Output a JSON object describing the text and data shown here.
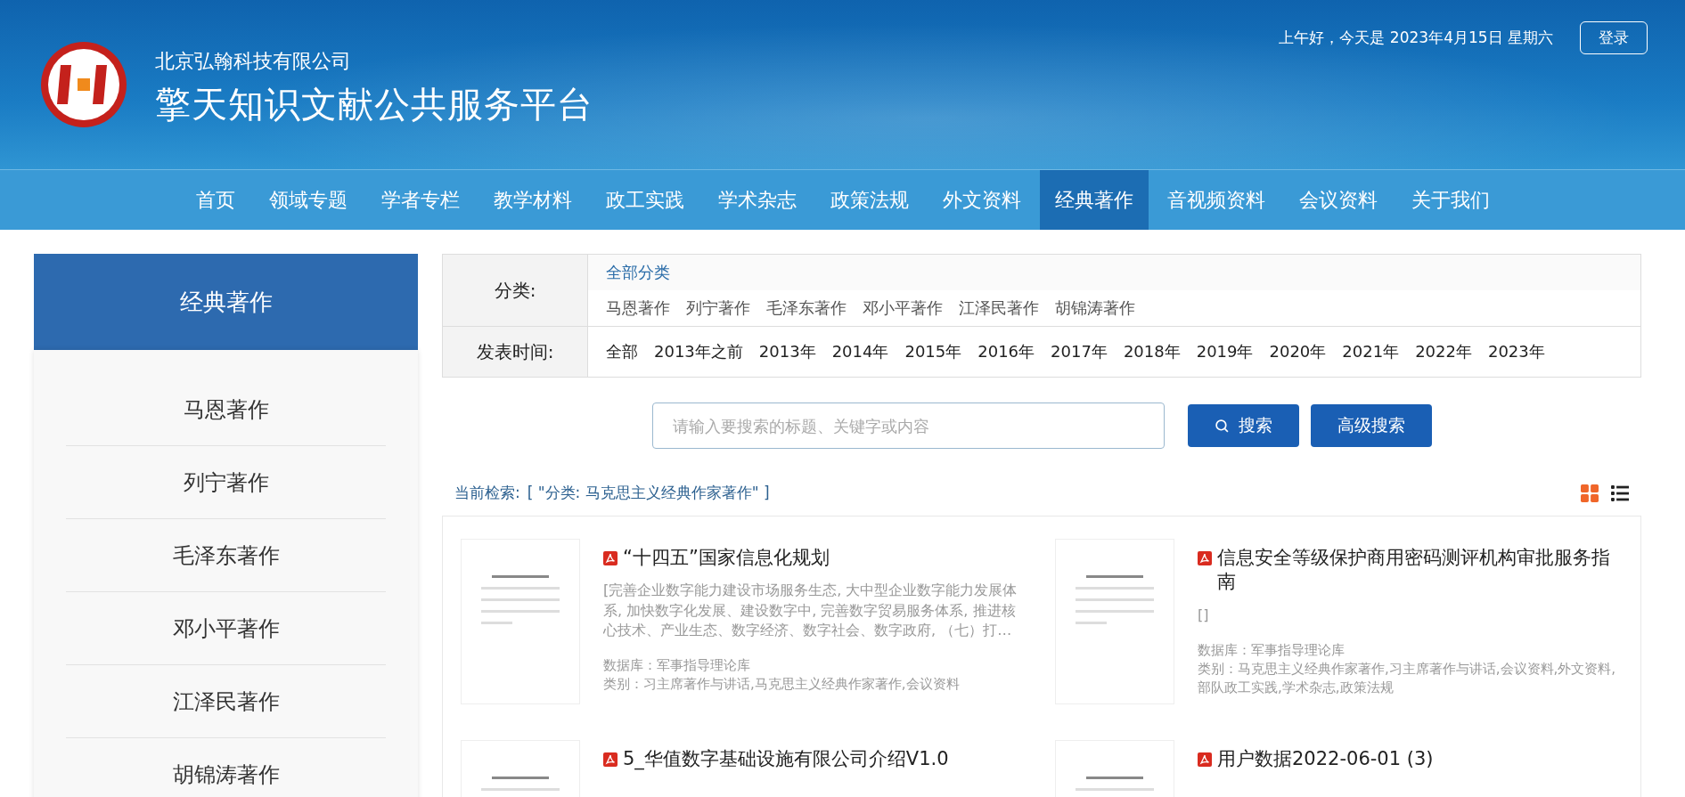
{
  "header": {
    "company": "北京弘翰科技有限公司",
    "platform": "擎天知识文献公共服务平台",
    "greeting": "上午好，今天是 2023年4月15日 星期六",
    "login": "登录"
  },
  "nav": [
    {
      "label": "首页",
      "selected": false
    },
    {
      "label": "领域专题",
      "selected": false
    },
    {
      "label": "学者专栏",
      "selected": false
    },
    {
      "label": "教学材料",
      "selected": false
    },
    {
      "label": "政工实践",
      "selected": false
    },
    {
      "label": "学术杂志",
      "selected": false
    },
    {
      "label": "政策法规",
      "selected": false
    },
    {
      "label": "外文资料",
      "selected": false
    },
    {
      "label": "经典著作",
      "selected": true
    },
    {
      "label": "音视频资料",
      "selected": false
    },
    {
      "label": "会议资料",
      "selected": false
    },
    {
      "label": "关于我们",
      "selected": false
    }
  ],
  "sidebar": {
    "title": "经典著作",
    "items": [
      "马恩著作",
      "列宁著作",
      "毛泽东著作",
      "邓小平著作",
      "江泽民著作",
      "胡锦涛著作"
    ]
  },
  "filters": {
    "category_label": "分类:",
    "categories": [
      {
        "label": "全部分类",
        "selected": true
      },
      {
        "label": "马恩著作",
        "selected": false
      },
      {
        "label": "列宁著作",
        "selected": false
      },
      {
        "label": "毛泽东著作",
        "selected": false
      },
      {
        "label": "邓小平著作",
        "selected": false
      },
      {
        "label": "江泽民著作",
        "selected": false
      },
      {
        "label": "胡锦涛著作",
        "selected": false
      }
    ],
    "time_label": "发表时间:",
    "times": [
      {
        "label": "全部",
        "selected": false
      },
      {
        "label": "2013年之前",
        "selected": false
      },
      {
        "label": "2013年",
        "selected": false
      },
      {
        "label": "2014年",
        "selected": false
      },
      {
        "label": "2015年",
        "selected": false
      },
      {
        "label": "2016年",
        "selected": false
      },
      {
        "label": "2017年",
        "selected": false
      },
      {
        "label": "2018年",
        "selected": false
      },
      {
        "label": "2019年",
        "selected": false
      },
      {
        "label": "2020年",
        "selected": false
      },
      {
        "label": "2021年",
        "selected": false
      },
      {
        "label": "2022年",
        "selected": false
      },
      {
        "label": "2023年",
        "selected": false
      }
    ]
  },
  "search": {
    "placeholder": "请输入要搜索的标题、关键字或内容",
    "button": "搜索",
    "advanced": "高级搜索"
  },
  "current_search": {
    "label": "当前检索:",
    "value": "[ \"分类: 马克思主义经典作家著作\" ]"
  },
  "view_modes": [
    {
      "kind": "grid",
      "selected": true
    },
    {
      "kind": "list",
      "selected": false
    }
  ],
  "results": [
    {
      "title": "“十四五”国家信息化规划",
      "abstract": "[完善企业数字能力建设市场服务生态, 大中型企业数字能力发展体系, 加快数字化发展、建设数字中, 完善数字贸易服务体系, 推进核心技术、产业生态、数字经济、数字社会、数字政府, （七）打…",
      "database": "数据库：军事指导理论库",
      "category": "类别：习主席著作与讲话,马克思主义经典作家著作,会议资料"
    },
    {
      "title": "信息安全等级保护商用密码测评机构审批服务指南",
      "abstract": "[]",
      "database": "数据库：军事指导理论库",
      "category": "类别：马克思主义经典作家著作,习主席著作与讲话,会议资料,外文资料,部队政工实践,学术杂志,政策法规"
    },
    {
      "title": "5_华值数字基础设施有限公司介绍V1.0"
    },
    {
      "title": "用户数据2022-06-01 (3)"
    }
  ]
}
